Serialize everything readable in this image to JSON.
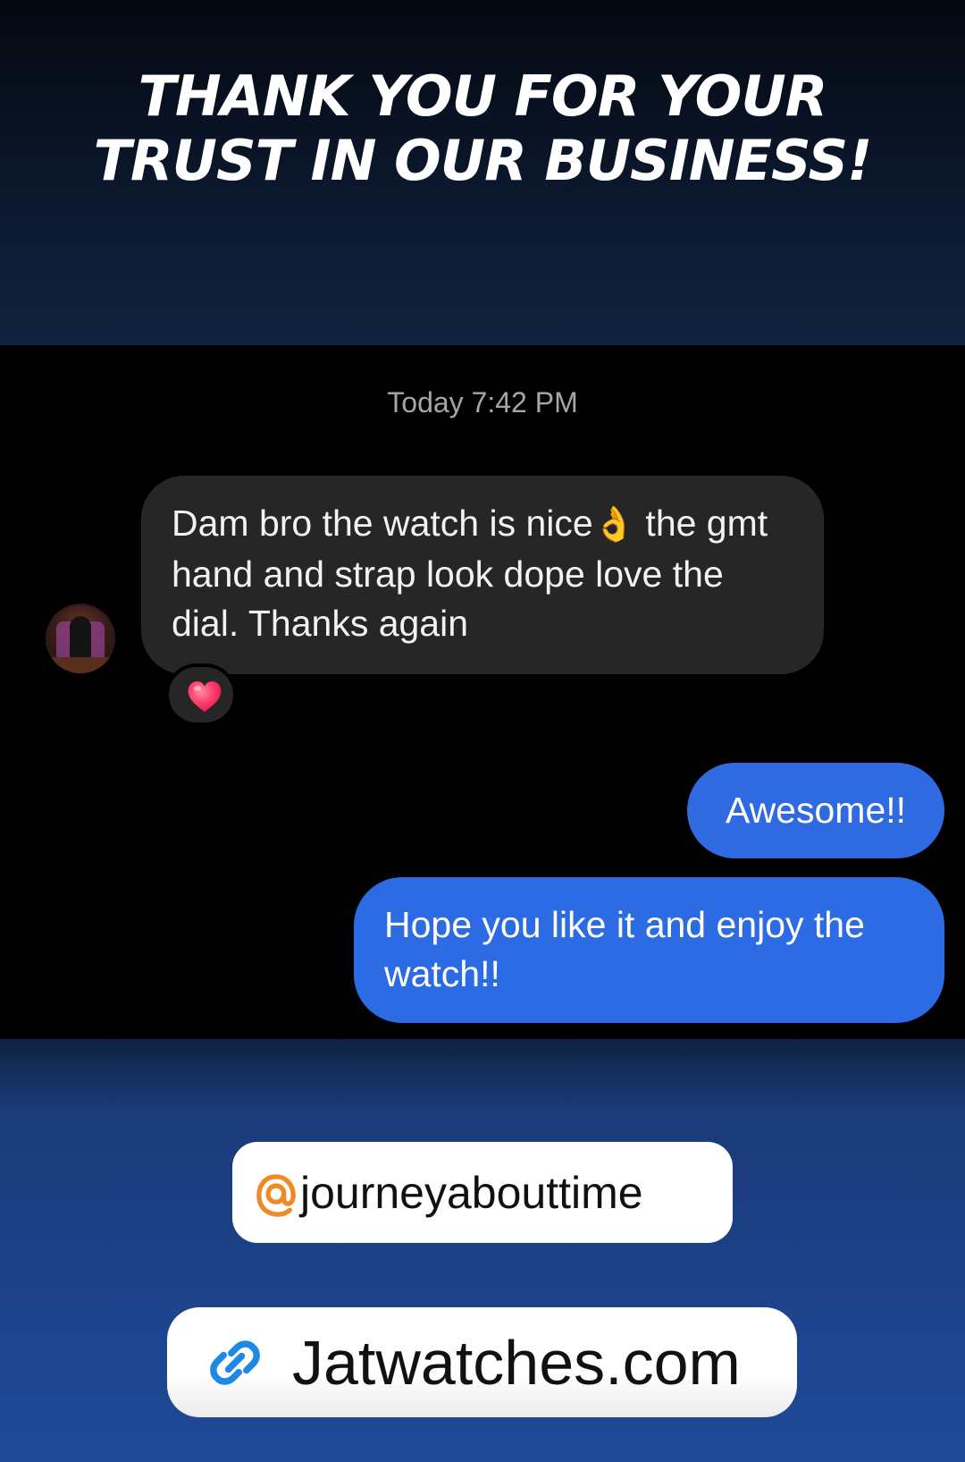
{
  "header": {
    "headline_line1": "THANK YOU FOR YOUR",
    "headline_line2": "TRUST IN OUR BUSINESS!"
  },
  "chat": {
    "timestamp": "Today 7:42 PM",
    "incoming_message": {
      "text_part1": "Dam bro the watch is nice",
      "emoji_name": "ok-hand-emoji",
      "emoji": "👌",
      "text_part2": " the gmt hand and strap look dope love the dial. Thanks again",
      "reaction": "heart",
      "reaction_color": "#ff3b6b"
    },
    "outgoing_messages": [
      {
        "text": "Awesome!!"
      },
      {
        "text": "Hope you like it and enjoy the watch!!"
      }
    ],
    "colors": {
      "incoming_bubble": "#262626",
      "outgoing_bubble": "#2f6ae0"
    }
  },
  "footer": {
    "handle": "journeyabouttime",
    "handle_icon": "threads-icon",
    "handle_icon_color": "#f08a24",
    "website": "Jatwatches.com",
    "website_icon": "link-icon",
    "website_icon_color": "#1e88e5"
  }
}
